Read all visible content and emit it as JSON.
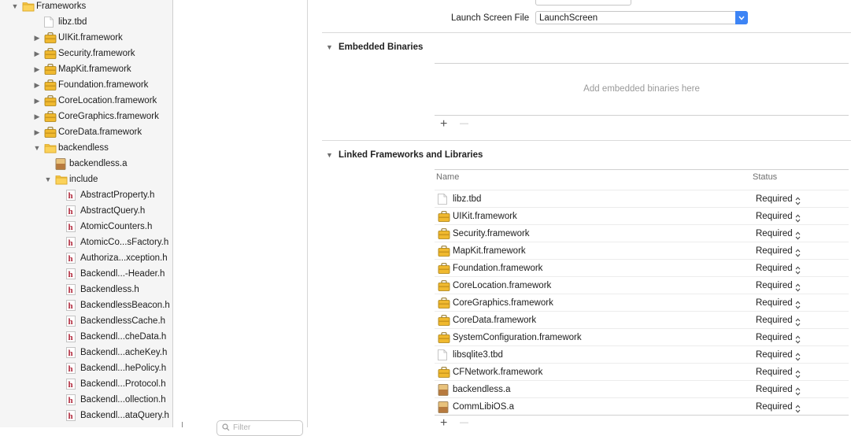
{
  "navigator": {
    "items": [
      {
        "label": "Frameworks",
        "icon": "folder-icon",
        "indent": 0,
        "disclosure": "open"
      },
      {
        "label": "libz.tbd",
        "icon": "file-icon",
        "indent": 1,
        "disclosure": "none"
      },
      {
        "label": "UIKit.framework",
        "icon": "framework-icon",
        "indent": 1,
        "disclosure": "closed"
      },
      {
        "label": "Security.framework",
        "icon": "framework-icon",
        "indent": 1,
        "disclosure": "closed"
      },
      {
        "label": "MapKit.framework",
        "icon": "framework-icon",
        "indent": 1,
        "disclosure": "closed"
      },
      {
        "label": "Foundation.framework",
        "icon": "framework-icon",
        "indent": 1,
        "disclosure": "closed"
      },
      {
        "label": "CoreLocation.framework",
        "icon": "framework-icon",
        "indent": 1,
        "disclosure": "closed"
      },
      {
        "label": "CoreGraphics.framework",
        "icon": "framework-icon",
        "indent": 1,
        "disclosure": "closed"
      },
      {
        "label": "CoreData.framework",
        "icon": "framework-icon",
        "indent": 1,
        "disclosure": "closed"
      },
      {
        "label": "backendless",
        "icon": "folder-icon",
        "indent": 1,
        "disclosure": "open"
      },
      {
        "label": "backendless.a",
        "icon": "library-icon",
        "indent": 2,
        "disclosure": "none"
      },
      {
        "label": "include",
        "icon": "folder-icon",
        "indent": 2,
        "disclosure": "open"
      },
      {
        "label": "AbstractProperty.h",
        "icon": "header-icon",
        "indent": 3,
        "disclosure": "none"
      },
      {
        "label": "AbstractQuery.h",
        "icon": "header-icon",
        "indent": 3,
        "disclosure": "none"
      },
      {
        "label": "AtomicCounters.h",
        "icon": "header-icon",
        "indent": 3,
        "disclosure": "none"
      },
      {
        "label": "AtomicCo...sFactory.h",
        "icon": "header-icon",
        "indent": 3,
        "disclosure": "none"
      },
      {
        "label": "Authoriza...xception.h",
        "icon": "header-icon",
        "indent": 3,
        "disclosure": "none"
      },
      {
        "label": "Backendl...-Header.h",
        "icon": "header-icon",
        "indent": 3,
        "disclosure": "none"
      },
      {
        "label": "Backendless.h",
        "icon": "header-icon",
        "indent": 3,
        "disclosure": "none"
      },
      {
        "label": "BackendlessBeacon.h",
        "icon": "header-icon",
        "indent": 3,
        "disclosure": "none"
      },
      {
        "label": "BackendlessCache.h",
        "icon": "header-icon",
        "indent": 3,
        "disclosure": "none"
      },
      {
        "label": "Backendl...cheData.h",
        "icon": "header-icon",
        "indent": 3,
        "disclosure": "none"
      },
      {
        "label": "Backendl...acheKey.h",
        "icon": "header-icon",
        "indent": 3,
        "disclosure": "none"
      },
      {
        "label": "Backendl...hePolicy.h",
        "icon": "header-icon",
        "indent": 3,
        "disclosure": "none"
      },
      {
        "label": "Backendl...Protocol.h",
        "icon": "header-icon",
        "indent": 3,
        "disclosure": "none"
      },
      {
        "label": "Backendl...ollection.h",
        "icon": "header-icon",
        "indent": 3,
        "disclosure": "none"
      },
      {
        "label": "Backendl...ataQuery.h",
        "icon": "header-icon",
        "indent": 3,
        "disclosure": "none"
      }
    ]
  },
  "filter": {
    "placeholder": "Filter"
  },
  "general": {
    "launch_screen_label": "Launch Screen File",
    "launch_screen_value": "LaunchScreen"
  },
  "embedded": {
    "title": "Embedded Binaries",
    "empty_text": "Add embedded binaries here",
    "add": "+",
    "remove": "—"
  },
  "linked": {
    "title": "Linked Frameworks and Libraries",
    "col_name": "Name",
    "col_status": "Status",
    "add": "+",
    "remove": "—",
    "rows": [
      {
        "name": "libz.tbd",
        "icon": "file-icon",
        "status": "Required"
      },
      {
        "name": "UIKit.framework",
        "icon": "framework-icon",
        "status": "Required"
      },
      {
        "name": "Security.framework",
        "icon": "framework-icon",
        "status": "Required"
      },
      {
        "name": "MapKit.framework",
        "icon": "framework-icon",
        "status": "Required"
      },
      {
        "name": "Foundation.framework",
        "icon": "framework-icon",
        "status": "Required"
      },
      {
        "name": "CoreLocation.framework",
        "icon": "framework-icon",
        "status": "Required"
      },
      {
        "name": "CoreGraphics.framework",
        "icon": "framework-icon",
        "status": "Required"
      },
      {
        "name": "CoreData.framework",
        "icon": "framework-icon",
        "status": "Required"
      },
      {
        "name": "SystemConfiguration.framework",
        "icon": "framework-icon",
        "status": "Required"
      },
      {
        "name": "libsqlite3.tbd",
        "icon": "file-icon",
        "status": "Required"
      },
      {
        "name": "CFNetwork.framework",
        "icon": "framework-icon",
        "status": "Required"
      },
      {
        "name": "backendless.a",
        "icon": "library-icon",
        "status": "Required"
      },
      {
        "name": "CommLibiOS.a",
        "icon": "library-icon",
        "status": "Required"
      }
    ]
  }
}
